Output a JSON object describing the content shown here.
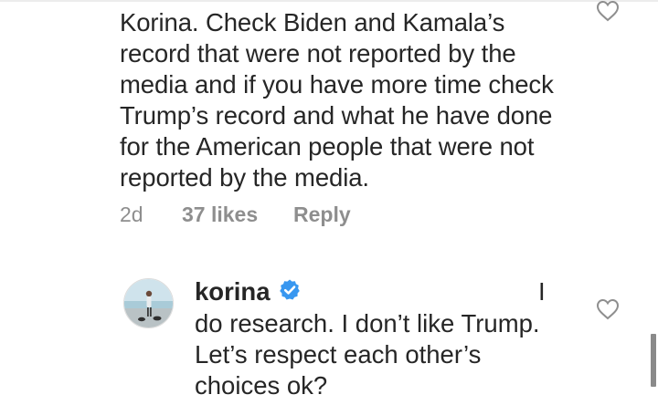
{
  "parent_comment": {
    "text": "Korina. Check Biden and Kamala’s\nrecord that were not reported by the\nmedia and if you have more time check\nTrump’s record and what he have done\nfor the American people that were not\nreported by the media.",
    "time": "2d",
    "likes": "37 likes",
    "reply_label": "Reply",
    "like_icon": "heart-outline-icon"
  },
  "reply_comment": {
    "username": "korina",
    "verified_icon": "verified-badge-icon",
    "cursor_char": "I",
    "text": "do research. I don’t like Trump.\nLet’s respect each other’s\nchoices ok?",
    "like_icon": "heart-outline-icon"
  },
  "colors": {
    "text": "#262626",
    "meta": "#8e8e8e",
    "verified_blue": "#3897f0",
    "icon_gray": "#8e8e8e"
  }
}
